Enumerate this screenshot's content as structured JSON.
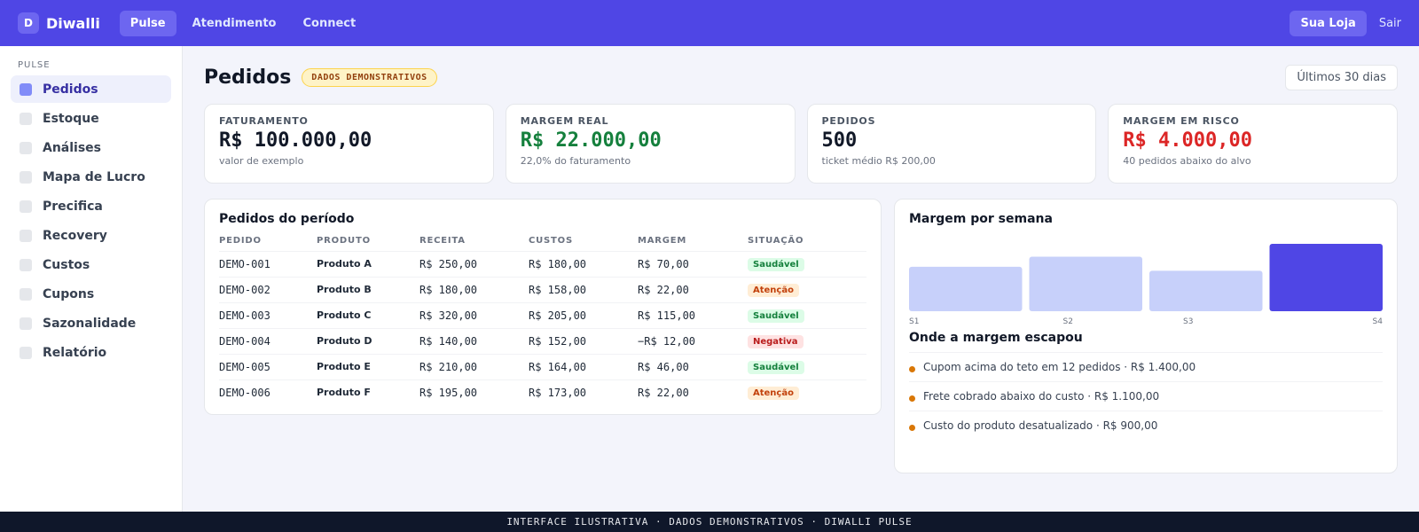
{
  "topbar": {
    "logo_letter": "D",
    "app_name": "Diwalli",
    "nav": [
      "Pulse",
      "Atendimento",
      "Connect"
    ],
    "store_label": "Sua Loja",
    "logout_label": "Sair"
  },
  "sidebar": {
    "section_title": "PULSE",
    "items": [
      "Pedidos",
      "Estoque",
      "Análises",
      "Mapa de Lucro",
      "Precifica",
      "Recovery",
      "Custos",
      "Cupons",
      "Sazonalidade",
      "Relatório"
    ]
  },
  "header": {
    "title": "Pedidos",
    "badge": "DADOS DEMONSTRATIVOS",
    "period": "Últimos 30 dias"
  },
  "kpis": [
    {
      "label": "FATURAMENTO",
      "value": "R$ 100.000,00",
      "sub": "valor de exemplo",
      "tone": "default"
    },
    {
      "label": "MARGEM REAL",
      "value": "R$ 22.000,00",
      "sub": "22,0% do faturamento",
      "tone": "green"
    },
    {
      "label": "PEDIDOS",
      "value": "500",
      "sub": "ticket médio R$ 200,00",
      "tone": "default"
    },
    {
      "label": "MARGEM EM RISCO",
      "value": "R$ 4.000,00",
      "sub": "40 pedidos abaixo do alvo",
      "tone": "red"
    }
  ],
  "orders": {
    "title": "Pedidos do período",
    "columns": [
      "PEDIDO",
      "PRODUTO",
      "RECEITA",
      "CUSTOS",
      "MARGEM",
      "SITUAÇÃO"
    ],
    "rows": [
      {
        "id": "DEMO-001",
        "product": "Produto A",
        "revenue": "R$ 250,00",
        "costs": "R$ 180,00",
        "margin": "R$ 70,00",
        "status": "Saudável",
        "status_type": "ok"
      },
      {
        "id": "DEMO-002",
        "product": "Produto B",
        "revenue": "R$ 180,00",
        "costs": "R$ 158,00",
        "margin": "R$ 22,00",
        "status": "Atenção",
        "status_type": "warn"
      },
      {
        "id": "DEMO-003",
        "product": "Produto C",
        "revenue": "R$ 320,00",
        "costs": "R$ 205,00",
        "margin": "R$ 115,00",
        "status": "Saudável",
        "status_type": "ok"
      },
      {
        "id": "DEMO-004",
        "product": "Produto D",
        "revenue": "R$ 140,00",
        "costs": "R$ 152,00",
        "margin": "−R$ 12,00",
        "status": "Negativa",
        "status_type": "neg"
      },
      {
        "id": "DEMO-005",
        "product": "Produto E",
        "revenue": "R$ 210,00",
        "costs": "R$ 164,00",
        "margin": "R$ 46,00",
        "status": "Saudável",
        "status_type": "ok"
      },
      {
        "id": "DEMO-006",
        "product": "Produto F",
        "revenue": "R$ 195,00",
        "costs": "R$ 173,00",
        "margin": "R$ 22,00",
        "status": "Atenção",
        "status_type": "warn"
      }
    ]
  },
  "chart_data": {
    "type": "bar",
    "title": "Margem por semana",
    "categories": [
      "S1",
      "S2",
      "S3",
      "S4"
    ],
    "values": [
      0.66,
      0.81,
      0.6,
      1.0
    ],
    "highlight_index": 3,
    "colors": {
      "bar": "#c7d0fa",
      "highlight": "#4f46e5"
    },
    "grid": false
  },
  "leaks": {
    "title": "Onde a margem escapou",
    "items": [
      "Cupom acima do teto em 12 pedidos · R$ 1.400,00",
      "Frete cobrado abaixo do custo · R$ 1.100,00",
      "Custo do produto desatualizado · R$ 900,00"
    ]
  },
  "footer": {
    "text": "INTERFACE ILUSTRATIVA · DADOS DEMONSTRATIVOS · DIWALLI PULSE"
  },
  "colors": {
    "brand": "#4f46e5",
    "positive": "#15803d",
    "negative": "#dc2626"
  }
}
